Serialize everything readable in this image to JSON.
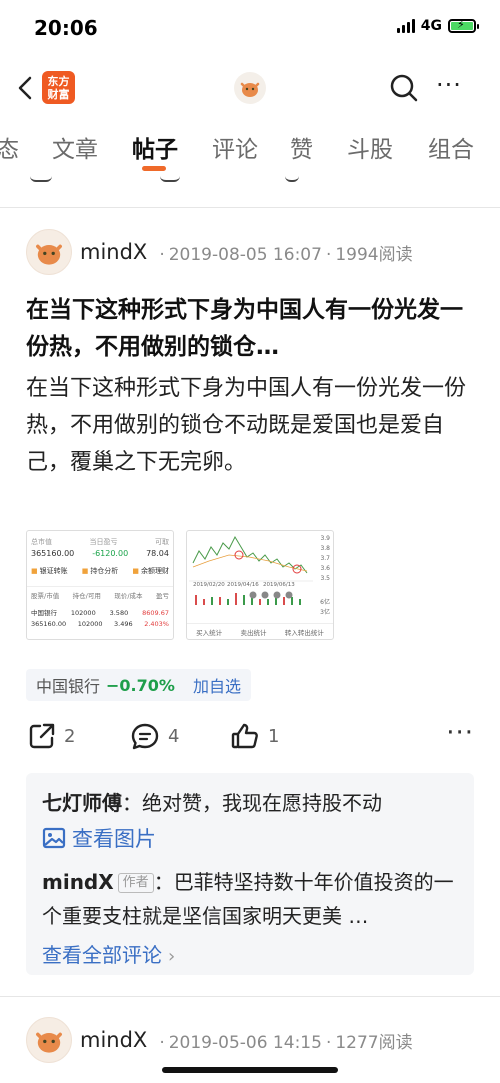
{
  "status": {
    "time": "20:06",
    "network": "4G"
  },
  "nav": {
    "logo_line1": "东方",
    "logo_line2": "财富",
    "icons": [
      "back-icon",
      "logo",
      "avatar",
      "search-icon",
      "more-icon"
    ]
  },
  "tabs": [
    {
      "label": "态"
    },
    {
      "label": "文章"
    },
    {
      "label": "帖子",
      "active": true
    },
    {
      "label": "评论"
    },
    {
      "label": "赞"
    },
    {
      "label": "斗股"
    },
    {
      "label": "组合"
    }
  ],
  "post": {
    "author": "mindX",
    "datetime": "2019-08-05 16:07",
    "reads": "1994阅读",
    "title": "在当下这种形式下身为中国人有一份光发一份热，不用做别的锁仓…",
    "body": "在当下这种形式下身为中国人有一份光发一份热，不用做别的锁仓不动既是爱国也是爱自己，覆巢之下无完卵。",
    "thumb1": {
      "head": [
        "总市值",
        "当日盈亏",
        "可取"
      ],
      "values": [
        "365160.00",
        "-6120.00",
        "78.04"
      ],
      "buttons": [
        "银证转账",
        "持仓分析",
        "余额理财"
      ],
      "table_header": [
        "股票/市值",
        "持仓/可用",
        "现价/成本",
        "盈亏"
      ],
      "row1": [
        "中国银行",
        "102000",
        "3.580",
        "8609.67"
      ],
      "row2": [
        "365160.00",
        "102000",
        "3.496",
        "2.403%"
      ]
    },
    "thumb2": {
      "axis": [
        "3.9",
        "3.8",
        "3.7",
        "3.6",
        "3.5",
        "6亿",
        "3亿"
      ],
      "dates": [
        "2019/02/20",
        "2019/04/16",
        "2019/06/13"
      ],
      "footer": [
        "买入统计",
        "卖出统计",
        "转入转出统计"
      ]
    },
    "stock": {
      "name": "中国银行",
      "change": "−0.70%",
      "watch": "加自选"
    },
    "actions": {
      "share_count": "2",
      "comment_count": "4",
      "like_count": "1"
    },
    "comments": [
      {
        "author": "七灯师傅",
        "text": "绝对赞，我现在愿持股不动"
      },
      {
        "author": "mindX",
        "tag": "作者",
        "text": "巴菲特坚持数十年价值投资的一个重要支柱就是坚信国家明天更美 …"
      }
    ],
    "view_image": "查看图片",
    "view_all": "查看全部评论"
  },
  "post2": {
    "author": "mindX",
    "datetime": "2019-05-06 14:15",
    "reads": "1277阅读"
  }
}
